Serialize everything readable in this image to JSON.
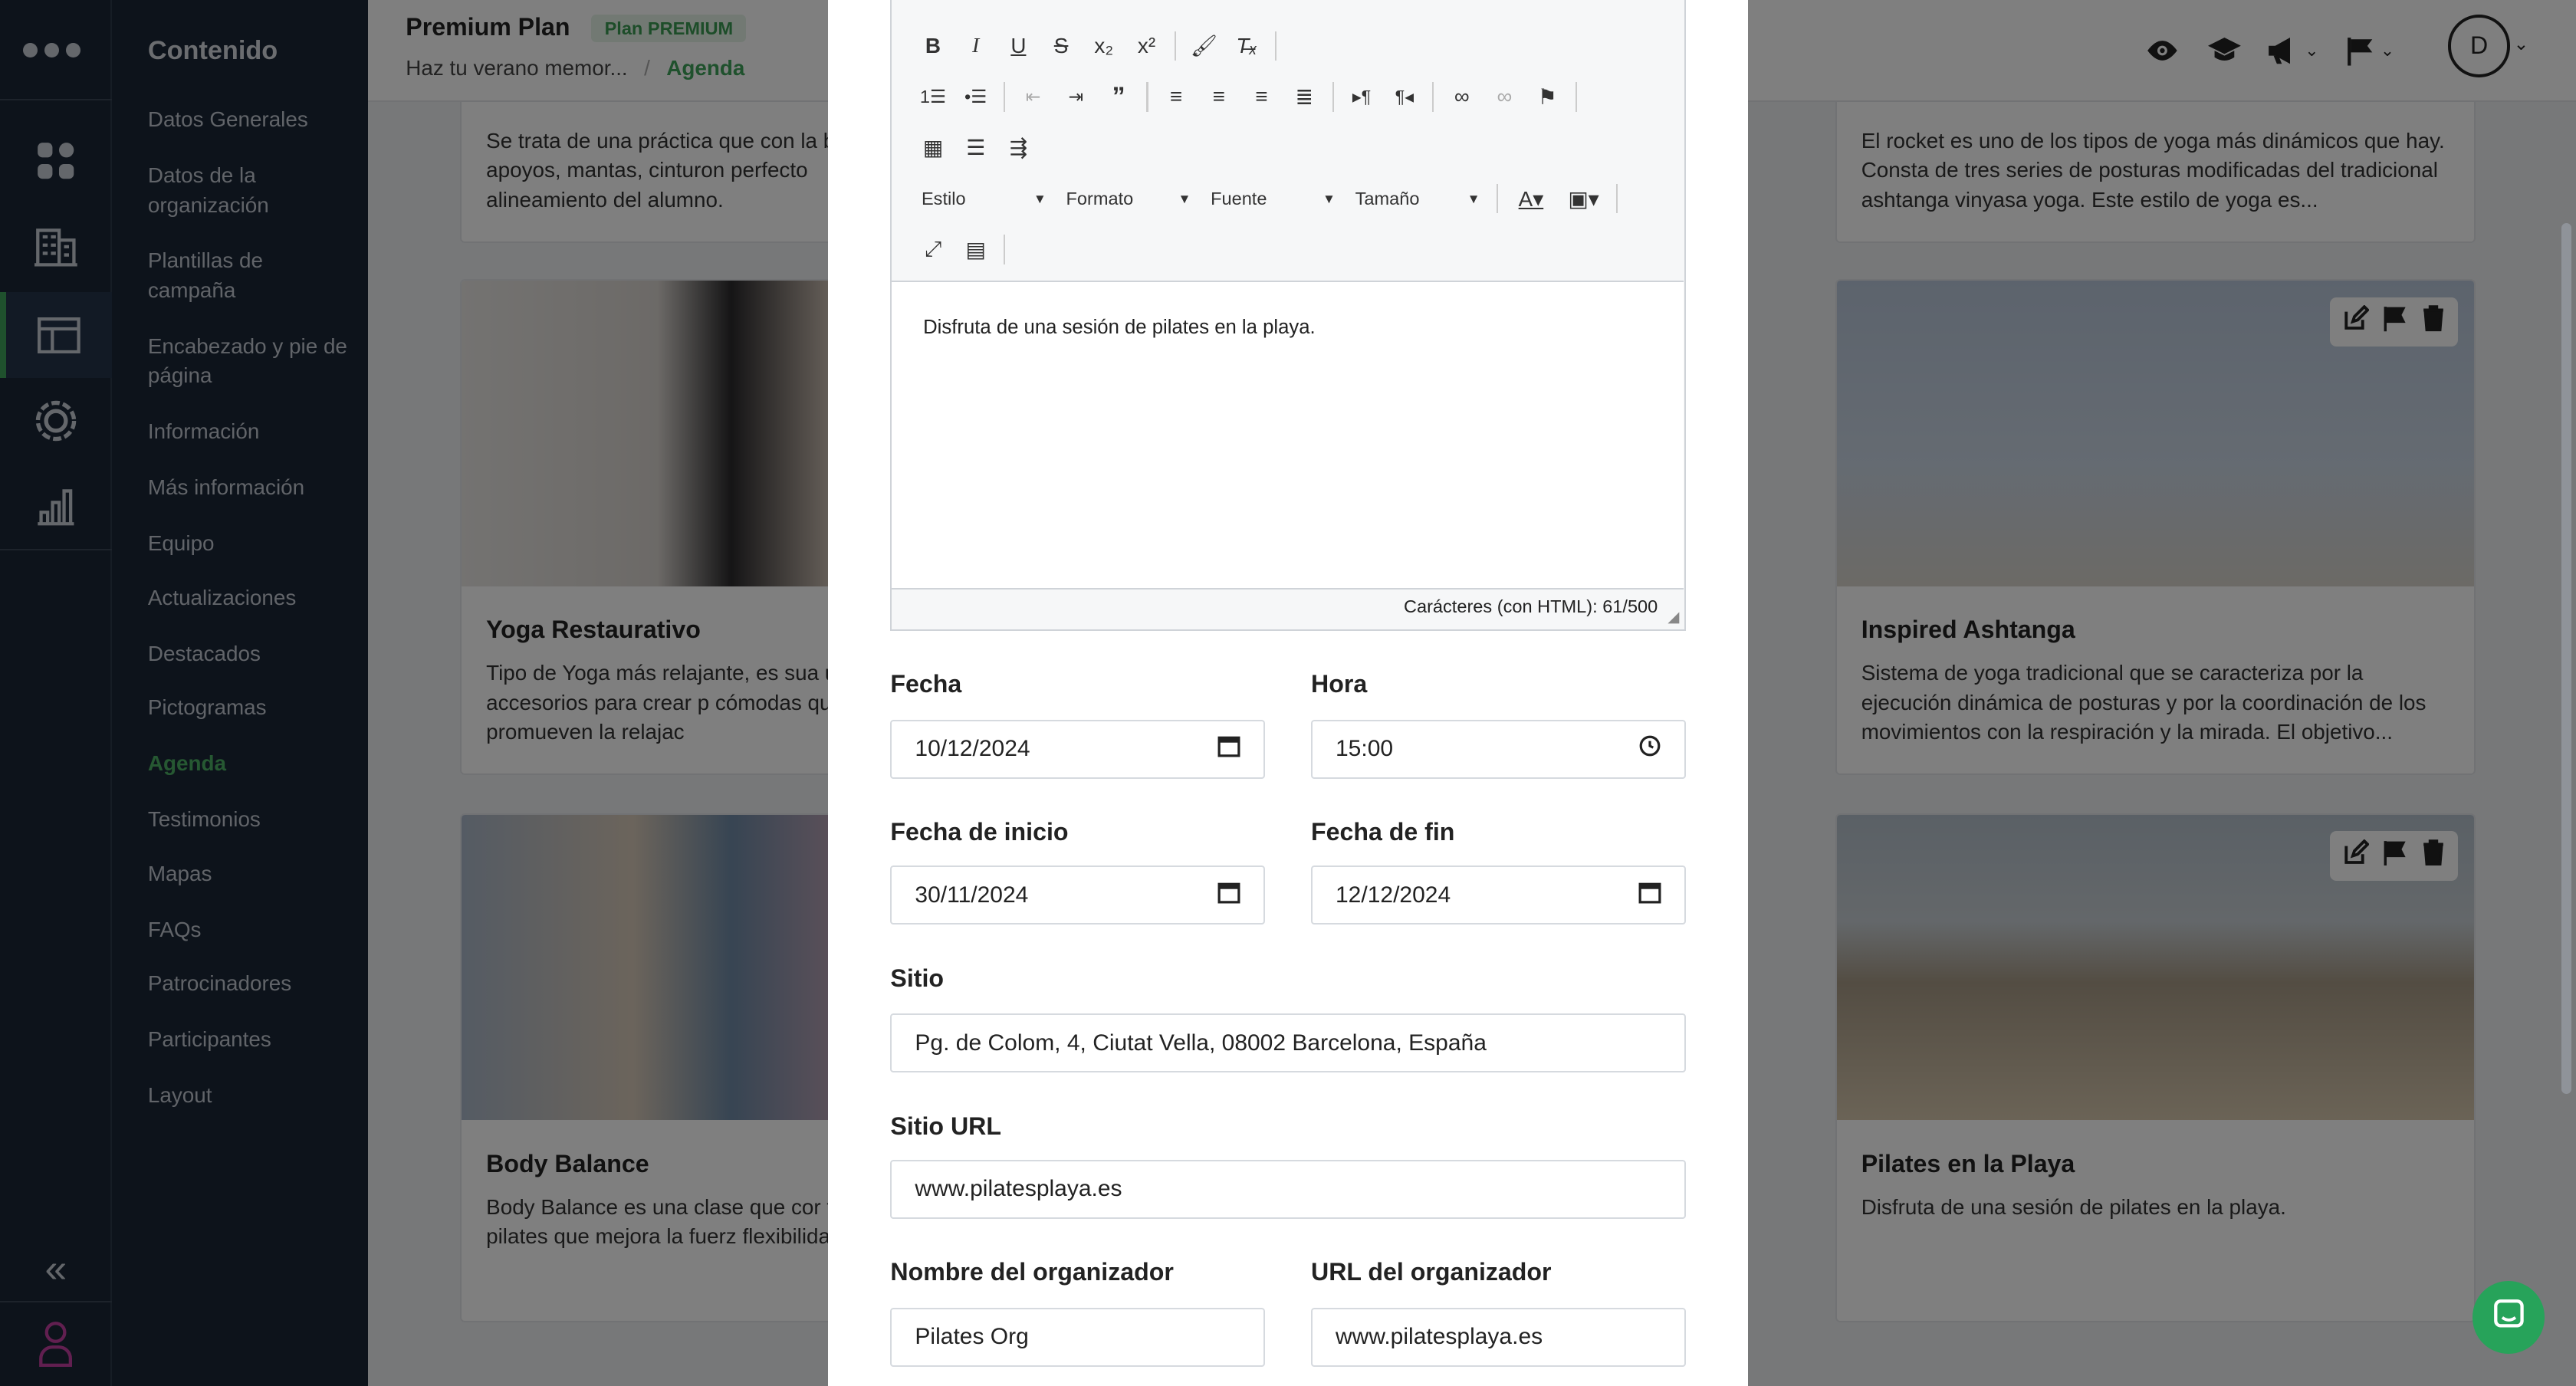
{
  "header": {
    "title": "Premium Plan",
    "plan_badge": "Plan PREMIUM",
    "breadcrumb": [
      "Haz tu verano memor...",
      "Agenda"
    ],
    "avatar_initial": "D"
  },
  "sidebar": {
    "title": "Contenido",
    "items": [
      {
        "label": "Datos Generales"
      },
      {
        "label": "Datos de la organización"
      },
      {
        "label": "Plantillas de campaña"
      },
      {
        "label": "Encabezado y pie de página"
      },
      {
        "label": "Información"
      },
      {
        "label": "Más información"
      },
      {
        "label": "Equipo"
      },
      {
        "label": "Actualizaciones"
      },
      {
        "label": "Destacados"
      },
      {
        "label": "Pictogramas"
      },
      {
        "label": "Agenda"
      },
      {
        "label": "Testimonios"
      },
      {
        "label": "Mapas"
      },
      {
        "label": "FAQs"
      },
      {
        "label": "Patrocinadores"
      },
      {
        "label": "Participantes"
      },
      {
        "label": "Layout"
      }
    ]
  },
  "cards": [
    {
      "title": "",
      "text": "Se trata de una práctica que con la bloques, apoyos, mantas, cinturon perfecto alineamiento del alumno."
    },
    {
      "title": "",
      "text": "El rocket es uno de los tipos de yoga más dinámicos que hay. Consta de tres series de posturas modificadas del tradicional ashtanga vinyasa yoga. Este estilo de yoga es..."
    },
    {
      "title": "Yoga Restaurativo",
      "text": "Tipo de Yoga más relajante, es sua utilizamos accesorios para crear p cómodas que promueven la relajac"
    },
    {
      "title": "Inspired Ashtanga",
      "text": "Sistema de yoga tradicional que se caracteriza por la ejecución dinámica de posturas y por la coordinación de los movimientos con la respiración y la mirada. El objetivo..."
    },
    {
      "title": "Body Balance",
      "text": "Body Balance es una clase que cor taichi y pilates que mejora la fuerz flexibilidad."
    },
    {
      "title": "Pilates en la Playa",
      "text": "Disfruta de una sesión de pilates en la playa."
    }
  ],
  "editor": {
    "style_combo": "Estilo",
    "format_combo": "Formato",
    "font_combo": "Fuente",
    "size_combo": "Tamaño",
    "content": "Disfruta de una sesión de pilates en la playa.",
    "char_count": "Carácteres (con HTML): 61/500"
  },
  "form": {
    "fecha_label": "Fecha",
    "fecha_value": "10/12/2024",
    "hora_label": "Hora",
    "hora_value": "15:00",
    "inicio_label": "Fecha de inicio",
    "inicio_value": "30/11/2024",
    "fin_label": "Fecha de fin",
    "fin_value": "12/12/2024",
    "sitio_label": "Sitio",
    "sitio_value": "Pg. de Colom, 4, Ciutat Vella, 08002 Barcelona, España",
    "sitio_url_label": "Sitio URL",
    "sitio_url_value": "www.pilatesplaya.es",
    "organizador_label": "Nombre del organizador",
    "organizador_value": "Pilates Org",
    "organizador_url_label": "URL del organizador",
    "organizador_url_value": "www.pilatesplaya.es"
  },
  "colors": {
    "accent": "#3fa35a",
    "sidebar": "#1b2736",
    "chat": "#27a35a"
  }
}
